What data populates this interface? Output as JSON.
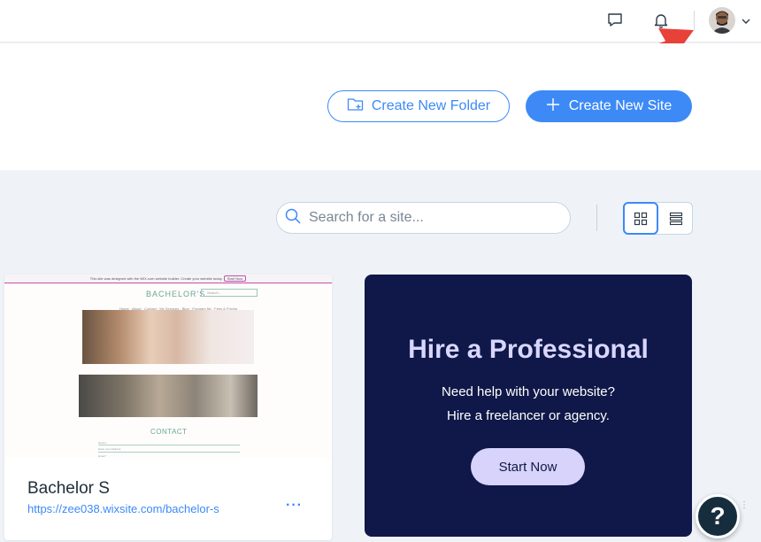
{
  "topbar": {
    "icons": [
      "chat-icon",
      "bell-icon",
      "chevron-down-icon"
    ]
  },
  "actions": {
    "create_folder_label": "Create New Folder",
    "create_site_label": "Create New Site"
  },
  "search": {
    "placeholder": "Search for a site..."
  },
  "view": {
    "selected": "grid"
  },
  "site_card": {
    "name": "Bachelor S",
    "url": "https://zee038.wixsite.com/bachelor-s",
    "more": "···",
    "thumbnail": {
      "banner": "This site was designed with the WIX.com website builder. Create your website today.",
      "banner_button": "Start Now",
      "brand": "BACHELOR'S",
      "search": "Search...",
      "menu": "Home · About · Contact · My Services · Blog · Program list · Fees & Pricing",
      "contact": "CONTACT",
      "field_name": "Name *",
      "field_address": "Enter your address",
      "field_email": "Email *"
    }
  },
  "promo": {
    "title": "Hire a Professional",
    "line1": "Need help with your website?",
    "line2": "Hire a freelancer or agency.",
    "button": "Start Now"
  },
  "help": {
    "label": "?",
    "handle": "⋮"
  },
  "colors": {
    "accent": "#3d8af7",
    "promo_bg": "#0f1848",
    "promo_button": "#d8d3fb",
    "arrow": "#e8413a"
  }
}
